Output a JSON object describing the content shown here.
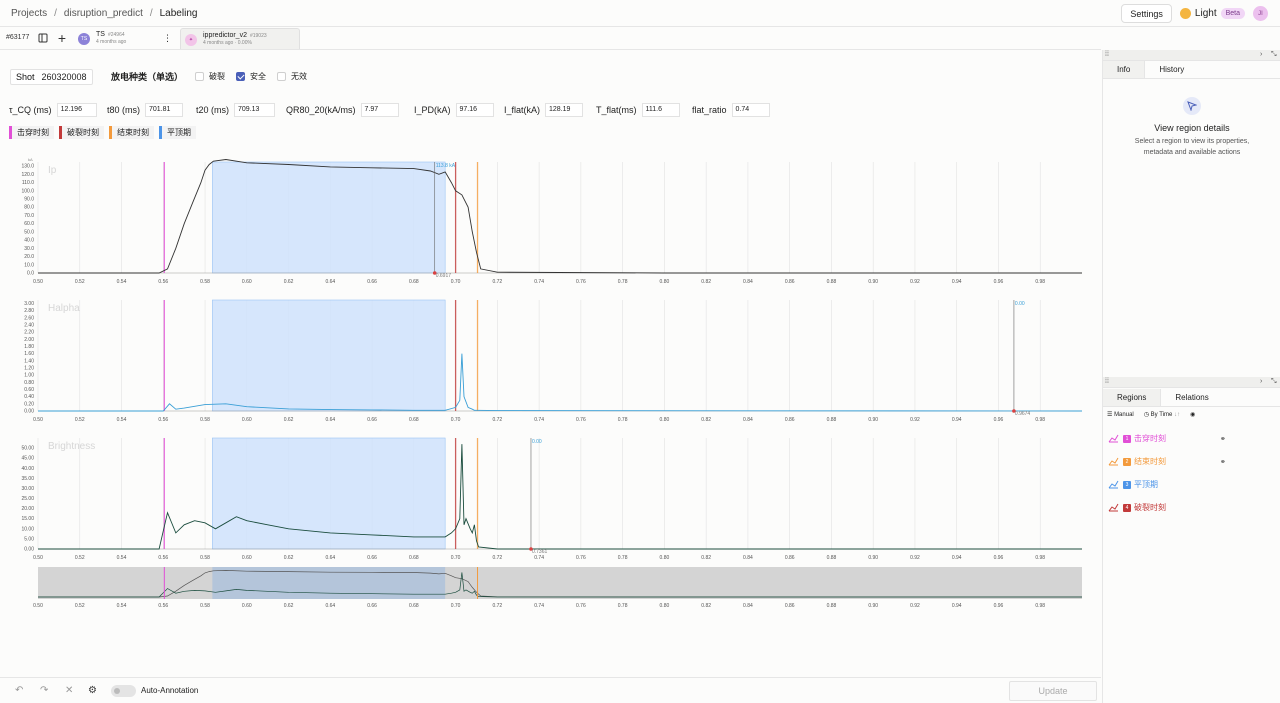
{
  "breadcrumb": {
    "projects": "Projects",
    "project": "disruption_predict",
    "page": "Labeling"
  },
  "header": {
    "settings": "Settings",
    "theme": "Light",
    "beta": "Beta",
    "user_initials": "JI"
  },
  "tabs": {
    "task_id": "#63177",
    "annotations": [
      {
        "initials": "TS",
        "name": "TS",
        "id": "#24964",
        "sub": "4 months ago",
        "color": "#8c82d8"
      },
      {
        "initials": "✦",
        "name": "ippredictor_v2",
        "id": "#19023",
        "sub": "4 months ago · 0.00%",
        "color": "#f2c4e8"
      }
    ]
  },
  "shot": {
    "label": "Shot",
    "value": "260320008"
  },
  "discharge": {
    "title": "放电种类（单选）",
    "options": [
      {
        "label": "破裂",
        "checked": false
      },
      {
        "label": "安全",
        "checked": true
      },
      {
        "label": "无效",
        "checked": false
      }
    ]
  },
  "metrics": [
    {
      "label": "τ_CQ (ms)",
      "value": "12.196"
    },
    {
      "label": "t80 (ms)",
      "value": "701.81"
    },
    {
      "label": "t20 (ms)",
      "value": "709.13"
    },
    {
      "label": "QR80_20(kA/ms)",
      "value": "7.97"
    },
    {
      "label": "I_PD(kA)",
      "value": "97.16"
    },
    {
      "label": "I_flat(kA)",
      "value": "128.19"
    },
    {
      "label": "T_flat(ms)",
      "value": "111.6"
    },
    {
      "label": "flat_ratio",
      "value": "0.74"
    }
  ],
  "label_buttons": [
    {
      "text": "击穿时刻",
      "color": "#e14fd6"
    },
    {
      "text": "破裂时刻",
      "color": "#c23a3a"
    },
    {
      "text": "结束时刻",
      "color": "#f39a3c"
    },
    {
      "text": "平顶期",
      "color": "#4c94e8"
    }
  ],
  "chart_data": [
    {
      "type": "line",
      "title": "Ip",
      "ylabel": "kA",
      "xlim": [
        0.5,
        1.0
      ],
      "ylim": [
        0,
        135
      ],
      "yticks": [
        0.0,
        10.0,
        20.0,
        30.0,
        40.0,
        50.0,
        60.0,
        70.0,
        80.0,
        90.0,
        100.0,
        110.0,
        120.0,
        130.0
      ],
      "xticks": [
        0.5,
        0.52,
        0.54,
        0.56,
        0.58,
        0.6,
        0.62,
        0.64,
        0.66,
        0.68,
        0.7,
        0.72,
        0.74,
        0.76,
        0.78,
        0.8,
        0.82,
        0.84,
        0.86,
        0.88,
        0.9,
        0.92,
        0.94,
        0.96,
        0.98
      ],
      "series": [
        {
          "color": "#333",
          "x": [
            0.5,
            0.558,
            0.562,
            0.566,
            0.57,
            0.574,
            0.578,
            0.58,
            0.582,
            0.584,
            0.59,
            0.6,
            0.62,
            0.64,
            0.66,
            0.68,
            0.688,
            0.692,
            0.695,
            0.698,
            0.7,
            0.703,
            0.706,
            0.708,
            0.71,
            0.712,
            0.72,
            0.8,
            0.9,
            1.0
          ],
          "y": [
            0,
            0,
            5,
            30,
            60,
            85,
            110,
            125,
            132,
            136,
            138,
            134,
            132,
            129,
            128,
            127,
            124,
            120,
            123,
            110,
            100,
            95,
            80,
            50,
            25,
            5,
            1,
            0,
            0,
            0
          ]
        }
      ],
      "annotations": [
        {
          "text": "113.8 kA",
          "x": 0.69
        },
        {
          "text": "0.6917",
          "x": 0.6917
        }
      ]
    },
    {
      "type": "line",
      "title": "Halpha",
      "xlim": [
        0.5,
        1.0
      ],
      "ylim": [
        0,
        3.1
      ],
      "yticks": [
        0.0,
        0.2,
        0.4,
        0.6,
        0.8,
        1.0,
        1.2,
        1.4,
        1.6,
        1.8,
        2.0,
        2.2,
        2.4,
        2.6,
        2.8,
        3.0
      ],
      "xticks": [
        0.5,
        0.52,
        0.54,
        0.56,
        0.58,
        0.6,
        0.62,
        0.64,
        0.66,
        0.68,
        0.7,
        0.72,
        0.74,
        0.76,
        0.78,
        0.8,
        0.82,
        0.84,
        0.86,
        0.88,
        0.9,
        0.92,
        0.94,
        0.96,
        0.98
      ],
      "series": [
        {
          "color": "#3a9fd6",
          "x": [
            0.5,
            0.56,
            0.563,
            0.566,
            0.57,
            0.58,
            0.59,
            0.6,
            0.62,
            0.64,
            0.66,
            0.68,
            0.695,
            0.7,
            0.702,
            0.703,
            0.704,
            0.706,
            0.708,
            0.709,
            0.71,
            0.72,
            1.0
          ],
          "y": [
            0,
            0,
            0.2,
            0.05,
            0.08,
            0.18,
            0.2,
            0.12,
            0.06,
            0.04,
            0.03,
            0.02,
            0.02,
            0.1,
            0.3,
            1.6,
            0.4,
            0.1,
            0.05,
            0.02,
            0.02,
            0.01,
            0
          ]
        }
      ],
      "annotations": [
        {
          "text": "0.00",
          "x": 0.9674
        },
        {
          "text": "0.9674",
          "x": 0.9674
        }
      ]
    },
    {
      "type": "line",
      "title": "Brightness",
      "xlim": [
        0.5,
        1.0
      ],
      "ylim": [
        0,
        55
      ],
      "yticks": [
        0.0,
        5.0,
        10.0,
        15.0,
        20.0,
        25.0,
        30.0,
        35.0,
        40.0,
        45.0,
        50.0
      ],
      "xticks": [
        0.5,
        0.52,
        0.54,
        0.56,
        0.58,
        0.6,
        0.62,
        0.64,
        0.66,
        0.68,
        0.7,
        0.72,
        0.74,
        0.76,
        0.78,
        0.8,
        0.82,
        0.84,
        0.86,
        0.88,
        0.9,
        0.92,
        0.94,
        0.96,
        0.98
      ],
      "series": [
        {
          "color": "#1b4d3e",
          "x": [
            0.5,
            0.558,
            0.562,
            0.566,
            0.57,
            0.575,
            0.58,
            0.585,
            0.59,
            0.595,
            0.6,
            0.61,
            0.62,
            0.64,
            0.66,
            0.68,
            0.695,
            0.698,
            0.7,
            0.702,
            0.703,
            0.704,
            0.705,
            0.707,
            0.708,
            0.709,
            0.71,
            0.711,
            0.72,
            1.0
          ],
          "y": [
            0,
            0,
            18,
            8,
            12,
            14,
            13,
            10,
            13,
            16,
            14,
            12,
            10,
            8,
            7,
            6,
            6,
            8,
            10,
            15,
            52,
            12,
            15,
            10,
            8,
            12,
            4,
            1,
            0,
            0
          ]
        }
      ],
      "annotations": [
        {
          "text": "0.00",
          "x": 0.7361
        },
        {
          "text": "0.7361",
          "x": 0.7361
        }
      ]
    }
  ],
  "right_panel": {
    "tabs": [
      "Info",
      "History"
    ],
    "empty_title": "View region details",
    "empty_text": "Select a region to view its properties, metadata and available actions",
    "region_tabs": [
      "Regions",
      "Relations"
    ],
    "tools": {
      "manual": "Manual",
      "sort": "By Time"
    },
    "regions": [
      {
        "num": "1",
        "label": "击穿时刻",
        "color": "#e14fd6",
        "link": true
      },
      {
        "num": "2",
        "label": "结束时刻",
        "color": "#f39a3c",
        "link": true
      },
      {
        "num": "3",
        "label": "平顶期",
        "color": "#4c94e8",
        "link": false
      },
      {
        "num": "4",
        "label": "破裂时刻",
        "color": "#c23a3a",
        "link": false
      }
    ]
  },
  "bottom": {
    "auto_annotation": "Auto-Annotation",
    "update": "Update"
  }
}
